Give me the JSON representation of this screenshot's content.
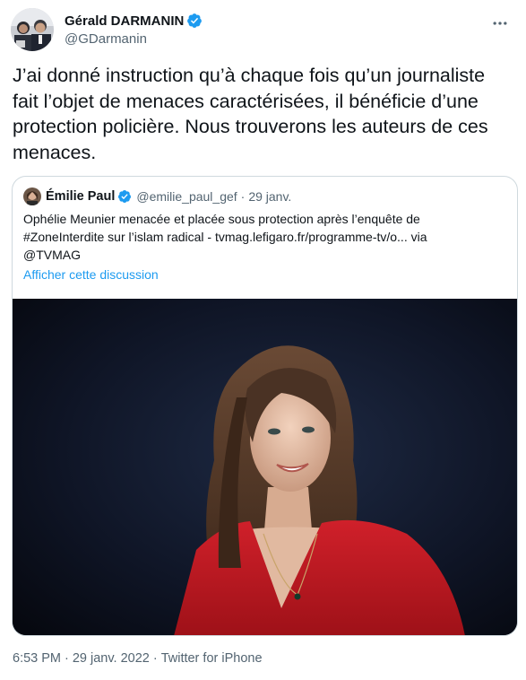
{
  "author": {
    "display_name": "Gérald DARMANIN",
    "handle": "@GDarmanin",
    "verified": true,
    "avatar_icon": "avatar-photo"
  },
  "tweet": {
    "text": "J’ai donné instruction qu’à chaque fois qu’un journaliste fait l’objet de menaces caractérisées, il bénéficie d’une protection policière. Nous trouverons les auteurs de ces menaces."
  },
  "quoted": {
    "display_name": "Émilie Paul",
    "handle": "@emilie_paul_gef",
    "separator": "·",
    "date": "29 janv.",
    "verified": true,
    "text_line1": "Ophélie Meunier menacée et placée sous protection après l’enquête de",
    "text_line2": "#ZoneInterdite sur l’islam radical - tvmag.lefigaro.fr/programme-tv/o... via",
    "text_line3": "@TVMAG",
    "show_thread": "Afficher cette discussion",
    "image_icon": "portrait-photo"
  },
  "footer": {
    "time": "6:53 PM",
    "date": "29 janv. 2022",
    "separator": "·",
    "source": "Twitter for iPhone"
  },
  "colors": {
    "text": "#0f1419",
    "secondary": "#536471",
    "link": "#1d9bf0",
    "verified": "#1d9bf0",
    "border": "#cfd9de",
    "dress": "#d0202a"
  }
}
